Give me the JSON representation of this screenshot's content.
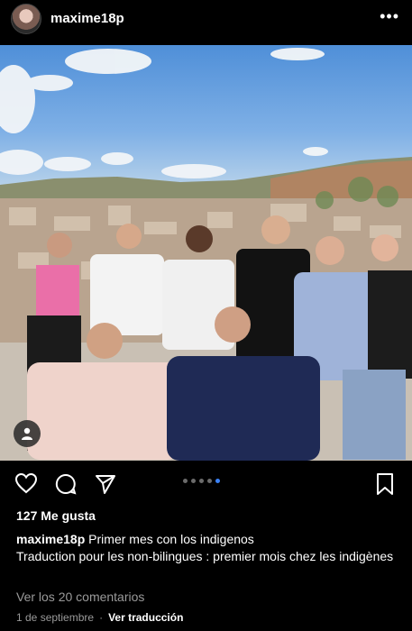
{
  "post": {
    "username": "maxime18p",
    "photo_alt": "",
    "likes_text": "127 Me gusta",
    "caption_user": "maxime18p",
    "caption_line1": "Primer mes con los indigenos",
    "caption_line2": "Traduction pour les non-bilingues : premier mois chez les indigènes",
    "view_comments": "Ver los 20 comentarios",
    "date": "1 de septiembre",
    "separator": "·",
    "translate": "Ver traducción",
    "carousel": {
      "count": 5,
      "active": 4
    }
  },
  "icons": {
    "more": "more-options-icon",
    "like": "heart-icon",
    "comment": "comment-icon",
    "share": "paper-plane-icon",
    "save": "bookmark-icon",
    "tag": "user-tag-icon"
  },
  "colors": {
    "background": "#000000",
    "text": "#ffffff",
    "muted": "#9a9a9a",
    "carousel_active": "#3b82f6"
  }
}
